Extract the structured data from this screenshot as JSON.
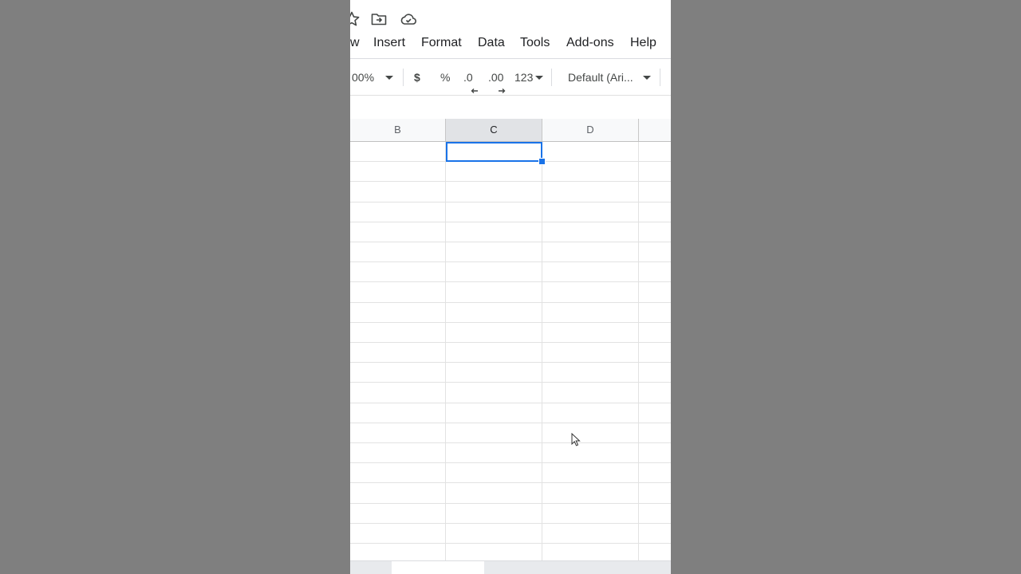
{
  "title_icons": [
    "star-icon",
    "move-to-folder-icon",
    "cloud-status-icon"
  ],
  "menu": {
    "items": [
      {
        "label": "w"
      },
      {
        "label": "Insert"
      },
      {
        "label": "Format"
      },
      {
        "label": "Data"
      },
      {
        "label": "Tools"
      },
      {
        "label": "Add-ons"
      },
      {
        "label": "Help"
      }
    ]
  },
  "toolbar": {
    "zoom": "00%",
    "currency": "$",
    "percent": "%",
    "decrease_decimal": ".0",
    "increase_decimal": ".00",
    "more_formats": "123",
    "font": "Default (Ari..."
  },
  "columns": [
    {
      "label": "B",
      "selected": false
    },
    {
      "label": "C",
      "selected": true
    },
    {
      "label": "D",
      "selected": false
    }
  ],
  "colors": {
    "selection": "#1a73e8",
    "background": "#7f7f7f"
  }
}
